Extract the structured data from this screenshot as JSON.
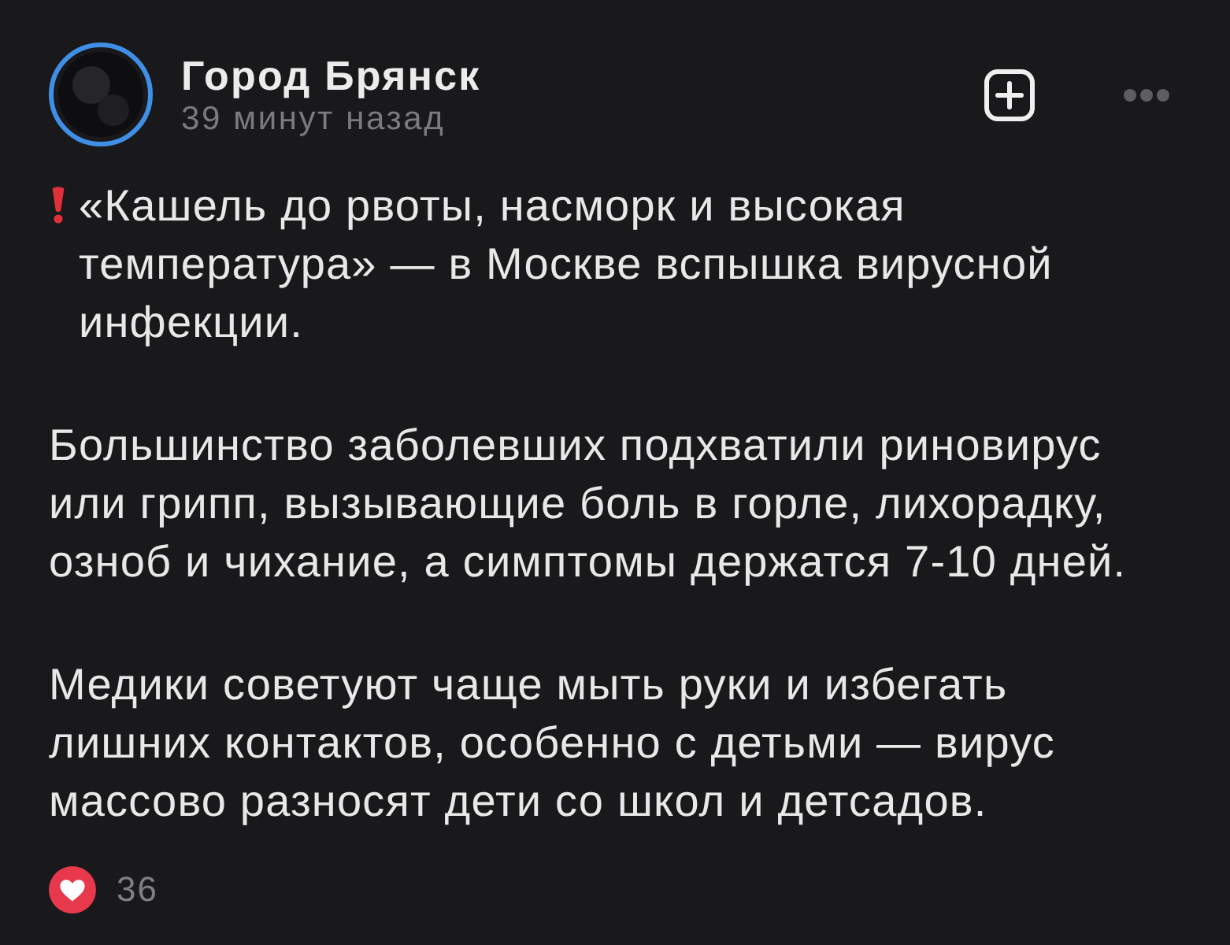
{
  "post": {
    "author": "Город Брянск",
    "time": "39 минут назад"
  },
  "paragraphs": [
    {
      "kind": "alert",
      "text": "«Кашель до рвоты, насморк и высокая\nтемпература» — в Москве вспышка вирусной\nинфекции."
    },
    {
      "kind": "plain",
      "text": "Большинство заболевших подхватили риновирус\nили грипп, вызывающие боль в горле, лихорадку,\nозноб и чихание, а симптомы держатся 7-10 дней."
    },
    {
      "kind": "plain",
      "text": "Медики советуют чаще мыть руки и избегать\nлишних контактов, особенно с детьми — вирус\nмассово разносят дети со школ и детсадов."
    }
  ],
  "reactions": {
    "count": "36"
  }
}
